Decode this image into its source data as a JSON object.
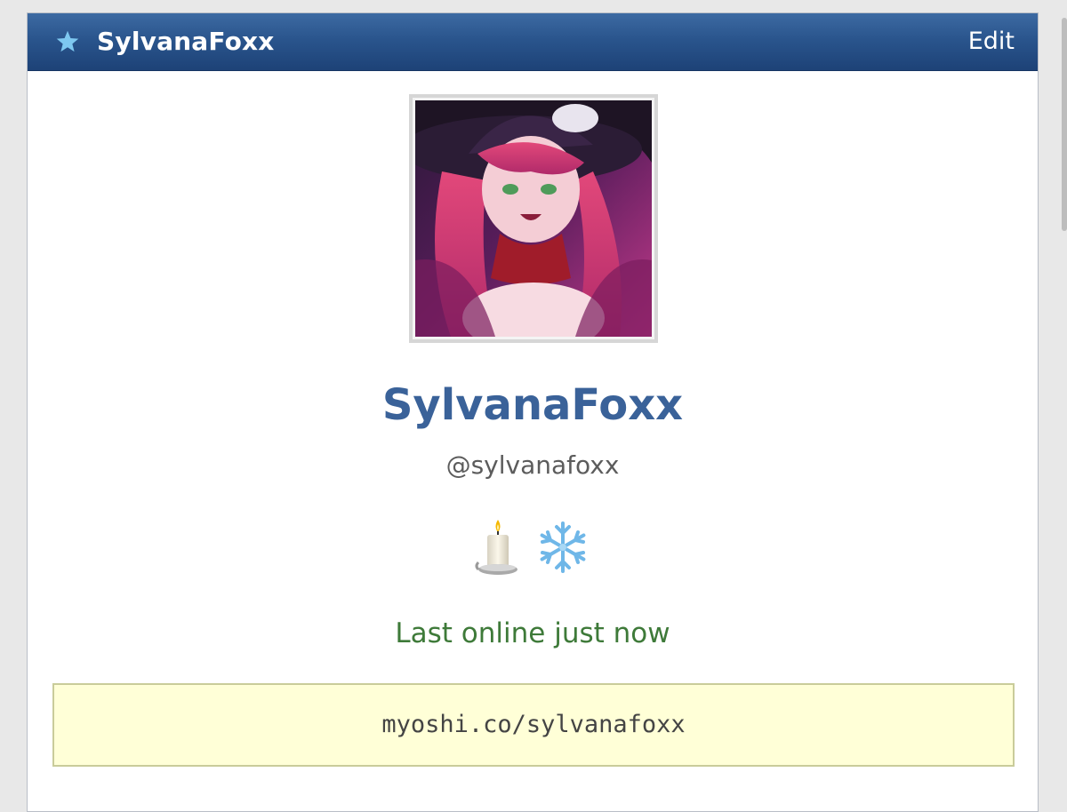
{
  "header": {
    "title": "SylvanaFoxx",
    "edit_label": "Edit",
    "icon": "star-icon"
  },
  "profile": {
    "display_name": "SylvanaFoxx",
    "handle": "@sylvanafoxx",
    "badges": [
      "candle-icon",
      "snowflake-icon"
    ],
    "last_online": "Last online just now",
    "url": "myoshi.co/sylvanafoxx"
  },
  "colors": {
    "header_bg": "#2a558d",
    "star": "#7ec8f0",
    "name": "#3a6299",
    "status": "#3e7a39",
    "url_bg": "#ffffd7"
  }
}
